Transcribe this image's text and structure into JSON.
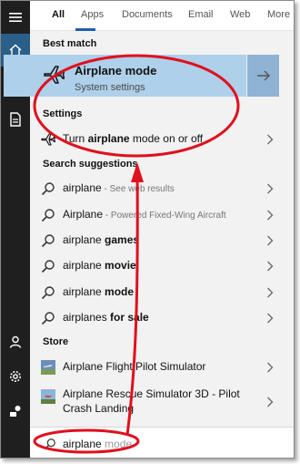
{
  "tabs": [
    "All",
    "Apps",
    "Documents",
    "Email",
    "Web",
    "More"
  ],
  "active_tab": "All",
  "sections": {
    "best_match": "Best match",
    "settings": "Settings",
    "search_suggestions": "Search suggestions",
    "store": "Store"
  },
  "best_match": {
    "title": "Airplane mode",
    "subtitle": "System settings",
    "icon": "airplane-icon",
    "action_icon": "arrow-right-icon"
  },
  "settings_items": [
    {
      "prefix": "Turn ",
      "bold": "airplane",
      "suffix": " mode on or off",
      "icon": "airplane-icon"
    }
  ],
  "suggestions": [
    {
      "main": "airplane",
      "bold": "",
      "detail": " - See web results"
    },
    {
      "main": "Airplane",
      "bold": "",
      "detail": " - Powered Fixed-Wing Aircraft"
    },
    {
      "main": "airplane ",
      "bold": "games",
      "detail": ""
    },
    {
      "main": "airplane ",
      "bold": "movie",
      "detail": ""
    },
    {
      "main": "airplane ",
      "bold": "mode",
      "detail": ""
    },
    {
      "main": "airplanes ",
      "bold": "for sale",
      "detail": ""
    }
  ],
  "store_items": [
    {
      "line1": "Airplane Flight Pilot Simulator",
      "line2": ""
    },
    {
      "line1": "Airplane Rescue Simulator 3D - Pilot",
      "line2": "Crash Landing"
    }
  ],
  "search": {
    "typed": "airplane",
    "ghost": " mode"
  },
  "colors": {
    "accent": "#1f5fa8",
    "best_match_bg": "#aed0ea",
    "annotation_red": "#e0101e",
    "rail_bg": "#1f1f1f"
  }
}
